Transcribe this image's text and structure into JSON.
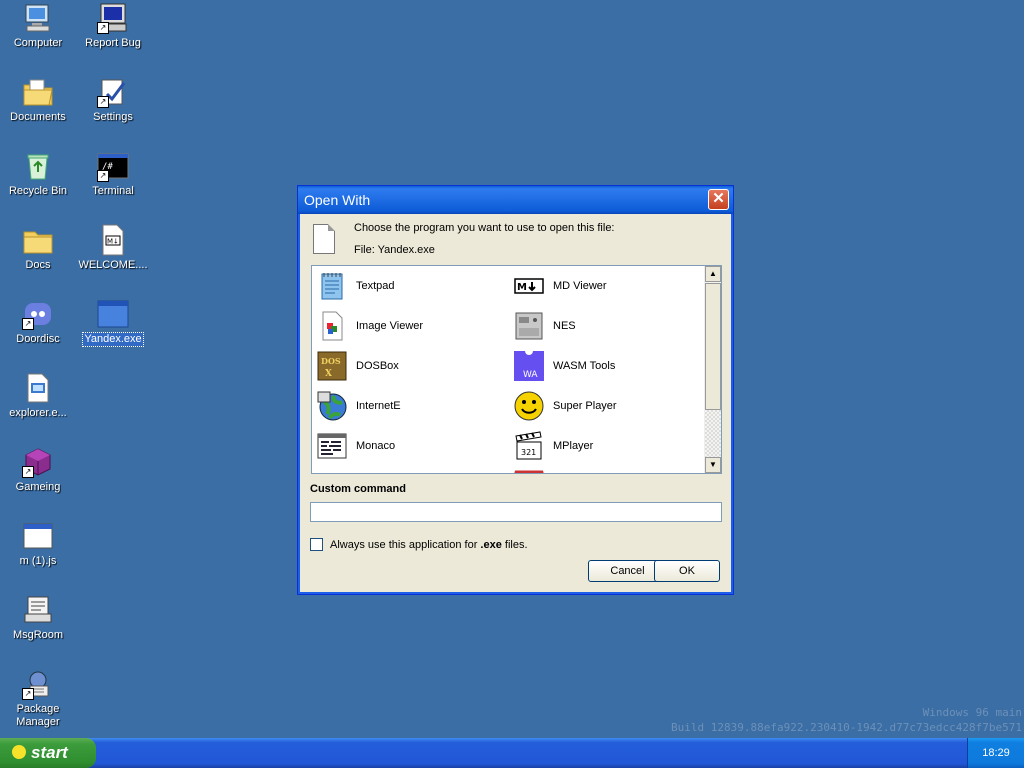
{
  "desktop": {
    "icons": [
      {
        "label": "Computer"
      },
      {
        "label": "Report Bug"
      },
      {
        "label": "Documents"
      },
      {
        "label": "Settings"
      },
      {
        "label": "Recycle Bin"
      },
      {
        "label": "Terminal"
      },
      {
        "label": "Docs"
      },
      {
        "label": "WELCOME...."
      },
      {
        "label": "Doordisc"
      },
      {
        "label": "Yandex.exe"
      },
      {
        "label": "explorer.e..."
      },
      {
        "label": "Gameing"
      },
      {
        "label": "m (1).js"
      },
      {
        "label": "MsgRoom"
      },
      {
        "label": "Package Manager"
      }
    ],
    "selected_icon": "Yandex.exe"
  },
  "dialog": {
    "title": "Open With",
    "close_label": "✕",
    "prompt": "Choose the program you want to use to open this file:",
    "file_label": "File: Yandex.exe",
    "programs": [
      {
        "label": "Textpad"
      },
      {
        "label": "MD Viewer"
      },
      {
        "label": "Image Viewer"
      },
      {
        "label": "NES"
      },
      {
        "label": "DOSBox"
      },
      {
        "label": "WASM Tools"
      },
      {
        "label": "InternetE"
      },
      {
        "label": "Super Player"
      },
      {
        "label": "Monaco"
      },
      {
        "label": "MPlayer"
      }
    ],
    "custom_command_label": "Custom command",
    "custom_command_value": "",
    "always_use_prefix": "Always use this application for ",
    "always_use_ext": ".exe",
    "always_use_suffix": " files.",
    "always_use_checked": false,
    "cancel_label": "Cancel",
    "ok_label": "OK"
  },
  "watermark": {
    "line1": "Windows 96 main",
    "line2": "Build 12839.88efa922.230410-1942.d77c73edcc428f7be571"
  },
  "taskbar": {
    "start_label": "start",
    "clock": "18:29"
  }
}
